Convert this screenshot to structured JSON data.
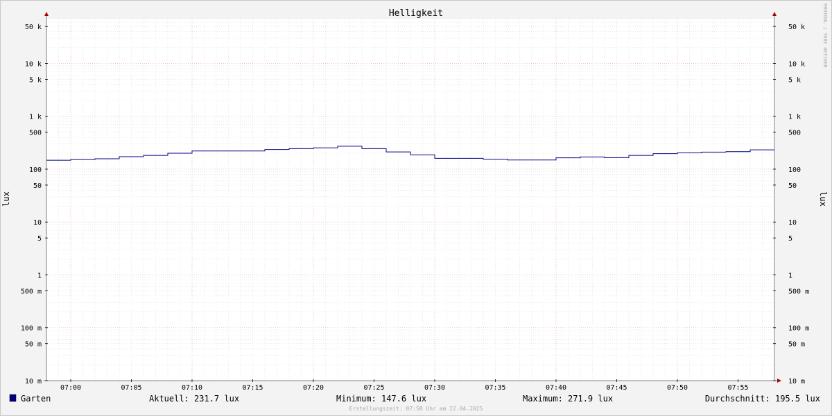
{
  "chart_data": {
    "type": "line",
    "title": "Helligkeit",
    "ylabel_left": "lux",
    "ylabel_right": "lux",
    "yscale": "log",
    "ylim": [
      0.01,
      70000
    ],
    "xlim_minutes": [
      "06:58",
      "07:58"
    ],
    "x_tick_labels": [
      "07:00",
      "07:05",
      "07:10",
      "07:15",
      "07:20",
      "07:25",
      "07:30",
      "07:35",
      "07:40",
      "07:45",
      "07:50",
      "07:55"
    ],
    "y_ticks": [
      {
        "value": 50000,
        "label": "50 k"
      },
      {
        "value": 10000,
        "label": "10 k"
      },
      {
        "value": 5000,
        "label": "5 k"
      },
      {
        "value": 1000,
        "label": "1 k"
      },
      {
        "value": 500,
        "label": "500"
      },
      {
        "value": 100,
        "label": "100"
      },
      {
        "value": 50,
        "label": "50"
      },
      {
        "value": 10,
        "label": "10"
      },
      {
        "value": 5,
        "label": "5"
      },
      {
        "value": 1,
        "label": "1"
      },
      {
        "value": 0.5,
        "label": "500 m"
      },
      {
        "value": 0.1,
        "label": "100 m"
      },
      {
        "value": 0.05,
        "label": "50 m"
      },
      {
        "value": 0.01,
        "label": "10 m"
      }
    ],
    "grid": true,
    "series": [
      {
        "name": "Garten",
        "color": "#000080",
        "step": true,
        "points": [
          {
            "x": "06:58",
            "y": 147.6
          },
          {
            "x": "07:00",
            "y": 152
          },
          {
            "x": "07:02",
            "y": 157
          },
          {
            "x": "07:04",
            "y": 172
          },
          {
            "x": "07:06",
            "y": 182
          },
          {
            "x": "07:08",
            "y": 200
          },
          {
            "x": "07:10",
            "y": 221
          },
          {
            "x": "07:16",
            "y": 235
          },
          {
            "x": "07:18",
            "y": 244
          },
          {
            "x": "07:20",
            "y": 253
          },
          {
            "x": "07:22",
            "y": 271.9
          },
          {
            "x": "07:24",
            "y": 244
          },
          {
            "x": "07:26",
            "y": 212
          },
          {
            "x": "07:28",
            "y": 186
          },
          {
            "x": "07:30",
            "y": 160
          },
          {
            "x": "07:34",
            "y": 154
          },
          {
            "x": "07:36",
            "y": 149
          },
          {
            "x": "07:40",
            "y": 164
          },
          {
            "x": "07:42",
            "y": 170
          },
          {
            "x": "07:44",
            "y": 165
          },
          {
            "x": "07:46",
            "y": 182
          },
          {
            "x": "07:48",
            "y": 196
          },
          {
            "x": "07:50",
            "y": 203
          },
          {
            "x": "07:52",
            "y": 210
          },
          {
            "x": "07:54",
            "y": 214
          },
          {
            "x": "07:56",
            "y": 231.7
          },
          {
            "x": "07:58",
            "y": 231.7
          }
        ]
      }
    ],
    "legend": {
      "series_name": "Garten",
      "swatch_color": "#000080",
      "current": "Aktuell: 231.7 lux",
      "minimum": "Minimum: 147.6 lux",
      "maximum": "Maximum: 271.9 lux",
      "average": "Durchschnitt: 195.5 lux"
    }
  },
  "watermark": "RRDTOOL / TOBI OETIKER",
  "footer": "Erstellungszeit: 07:58 Uhr am 22.04.2025",
  "colors": {
    "background": "#f3f3f3",
    "canvas": "#ffffff",
    "grid_minor": "#dddddd",
    "grid_major": "#e8a0a0",
    "axis": "#808080",
    "arrow": "#aa0000"
  }
}
